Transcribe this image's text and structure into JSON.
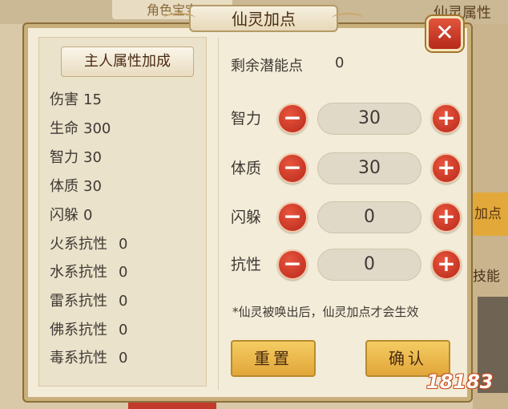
{
  "background": {
    "tab_left": "角色宝宝",
    "tab_right": "仙灵属性",
    "side_jiadian": "加点",
    "side_jineng": "技能",
    "watermark": "18183"
  },
  "dialog": {
    "title": "仙灵加点",
    "close_label": "✕"
  },
  "left": {
    "owner_button": "主人属性加成",
    "attributes": [
      {
        "label": "伤害",
        "value": "15"
      },
      {
        "label": "生命",
        "value": "300"
      },
      {
        "label": "智力",
        "value": "30"
      },
      {
        "label": "体质",
        "value": "30"
      },
      {
        "label": "闪躲",
        "value": "0"
      },
      {
        "label": "火系抗性",
        "value": "0"
      },
      {
        "label": "水系抗性",
        "value": "0"
      },
      {
        "label": "雷系抗性",
        "value": "0"
      },
      {
        "label": "佛系抗性",
        "value": "0"
      },
      {
        "label": "毒系抗性",
        "value": "0"
      }
    ]
  },
  "right": {
    "remaining_label": "剩余潜能点",
    "remaining_value": "0",
    "rows": [
      {
        "label": "智力",
        "value": "30"
      },
      {
        "label": "体质",
        "value": "30"
      },
      {
        "label": "闪躲",
        "value": "0"
      },
      {
        "label": "抗性",
        "value": "0"
      }
    ],
    "minus_symbol": "−",
    "plus_symbol": "+",
    "note": "*仙灵被唤出后，仙灵加点才会生效",
    "reset_label": "重置",
    "confirm_label": "确认"
  }
}
